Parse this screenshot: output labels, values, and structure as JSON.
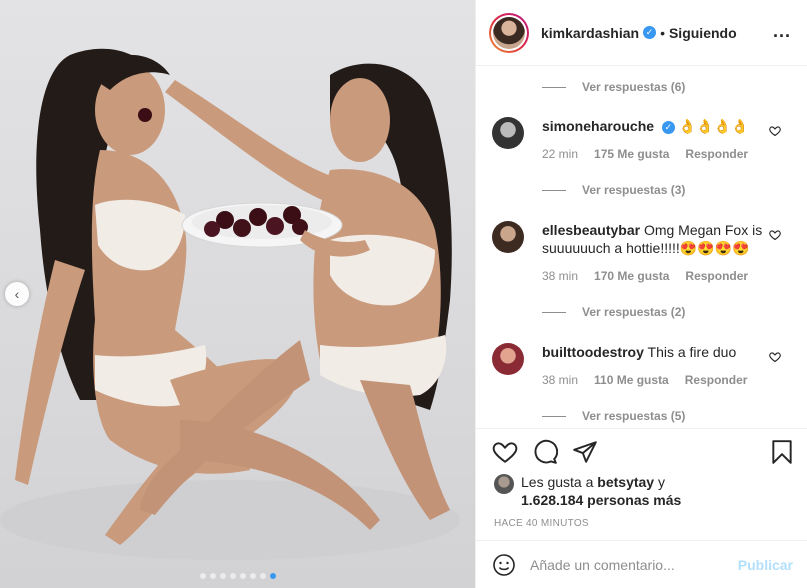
{
  "post": {
    "carousel_dot_count": 8,
    "carousel_active_index": 7
  },
  "header": {
    "username": "kimkardashian",
    "separator": "•",
    "follow_label": "Siguiendo",
    "more_label": "..."
  },
  "comments": [
    {
      "replies_label": "Ver respuestas (6)"
    },
    {
      "username": "simoneharouche",
      "verified": true,
      "text": "👌👌👌👌",
      "time": "22 min",
      "likes": "175 Me gusta",
      "reply_label": "Responder",
      "replies_label": "Ver respuestas (3)"
    },
    {
      "username": "ellesbeautybar",
      "verified": false,
      "text": "Omg Megan Fox is suuuuuuch a hottie!!!!!😍😍😍😍",
      "time": "38 min",
      "likes": "170 Me gusta",
      "reply_label": "Responder",
      "replies_label": "Ver respuestas (2)"
    },
    {
      "username": "builttoodestroy",
      "verified": false,
      "text": "This a fire duo",
      "time": "38 min",
      "likes": "110 Me gusta",
      "reply_label": "Responder",
      "replies_label": "Ver respuestas (5)"
    }
  ],
  "likes": {
    "prefix": "Les gusta a ",
    "user": "betsytay",
    "middle": " y",
    "count": "1.628.184 personas más"
  },
  "timestamp": "HACE 40 MINUTOS",
  "composer": {
    "placeholder": "Añade un comentario...",
    "publish_label": "Publicar"
  },
  "colors": {
    "link_blue": "#3897f0",
    "publish_disabled": "#b2dffc",
    "muted_text": "#8e8e8e"
  }
}
